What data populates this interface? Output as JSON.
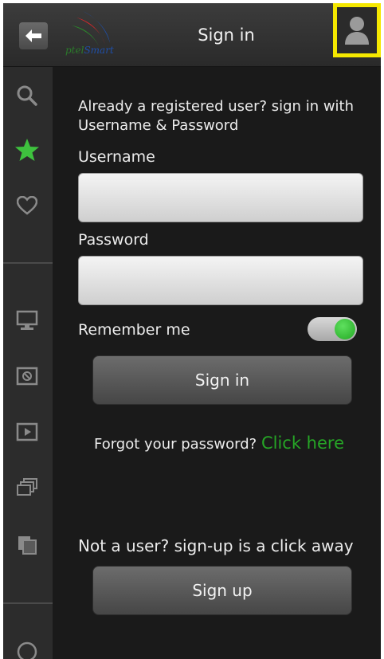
{
  "header": {
    "title": "Sign in",
    "logo_part1": "ptel",
    "logo_part2": "Smart",
    "back_icon": "back-arrow-icon",
    "user_icon": "user-icon"
  },
  "sidebar": {
    "items": [
      {
        "icon": "search-icon"
      },
      {
        "icon": "star-icon",
        "color": "#3ec23e"
      },
      {
        "icon": "heart-icon"
      },
      {
        "icon": "monitor-icon"
      },
      {
        "icon": "recorder-icon"
      },
      {
        "icon": "play-icon"
      },
      {
        "icon": "stack-icon"
      },
      {
        "icon": "copy-icon"
      }
    ]
  },
  "form": {
    "intro": "Already a registered user? sign in with Username & Password",
    "username_label": "Username",
    "username_value": "",
    "password_label": "Password",
    "password_value": "",
    "remember_label": "Remember me",
    "remember_on": true,
    "signin_label": "Sign in",
    "forgot_text": "Forgot your password?",
    "click_here": "Click here",
    "signup_note": "Not a user? sign-up is a click away",
    "signup_label": "Sign up"
  },
  "colors": {
    "highlight": "#f5e800",
    "accent_green": "#26a626"
  }
}
